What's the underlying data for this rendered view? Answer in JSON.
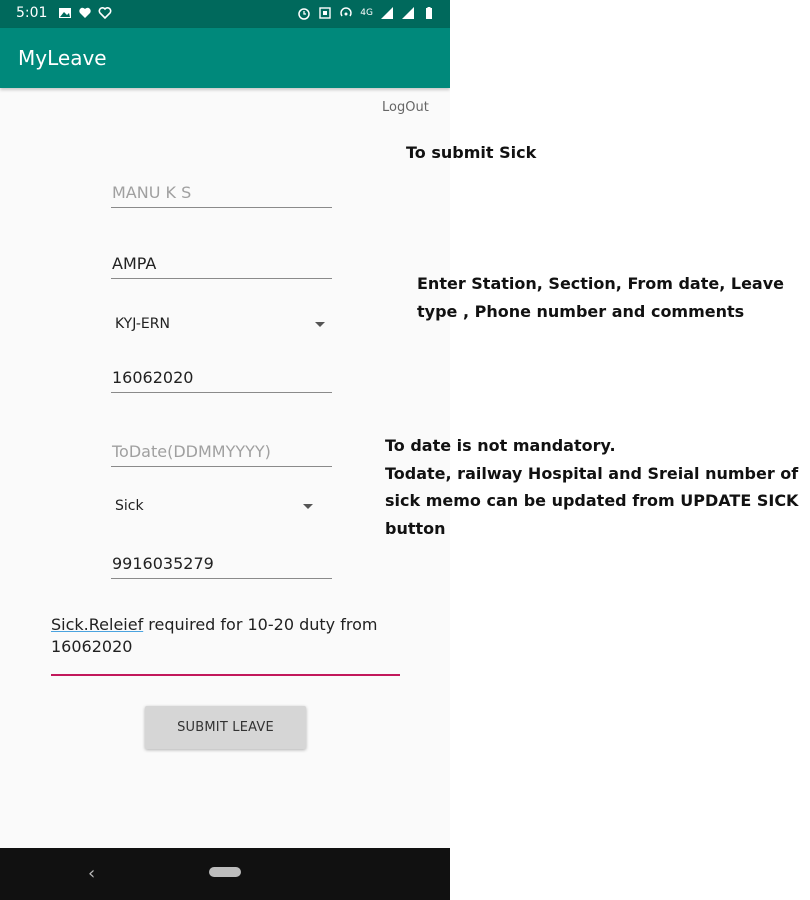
{
  "status_bar": {
    "time": "5:01",
    "left_icons": [
      "image-icon",
      "heart-icon",
      "health-icon"
    ],
    "right_icons": [
      "alarm-icon",
      "vibrate-icon",
      "hotspot-icon",
      "4g-icon",
      "signal-icon",
      "signal-icon",
      "battery-icon"
    ],
    "network_label": "4G"
  },
  "app_bar": {
    "title": "MyLeave"
  },
  "logout_label": "LogOut",
  "form": {
    "name": {
      "value": "",
      "placeholder": "MANU K S"
    },
    "station": {
      "value": "AMPA"
    },
    "section": {
      "selected": "KYJ-ERN"
    },
    "from_date": {
      "value": "16062020"
    },
    "to_date": {
      "value": "",
      "placeholder": "ToDate(DDMMYYYY)"
    },
    "leave_type": {
      "selected": "Sick"
    },
    "phone": {
      "value": "9916035279"
    },
    "comment": {
      "underlined": "Sick.Releief",
      "rest": " required for 10-20 duty from 16062020"
    },
    "submit_label": "SUBMIT LEAVE"
  },
  "nav": {
    "back_icon": "back-chevron-icon",
    "home_icon": "home-pill-icon"
  },
  "annotations": {
    "title": "To submit Sick",
    "fields": "Enter Station, Section, From date, Leave type , Phone number and comments",
    "todate": "To date is not mandatory.\nTodate, railway Hospital and Sreial number of sick memo can be updated from UPDATE SICK button"
  },
  "colors": {
    "status_bar": "#00695c",
    "app_bar": "#00897b",
    "accent_underline": "#c2185b",
    "button": "#d6d6d6"
  }
}
